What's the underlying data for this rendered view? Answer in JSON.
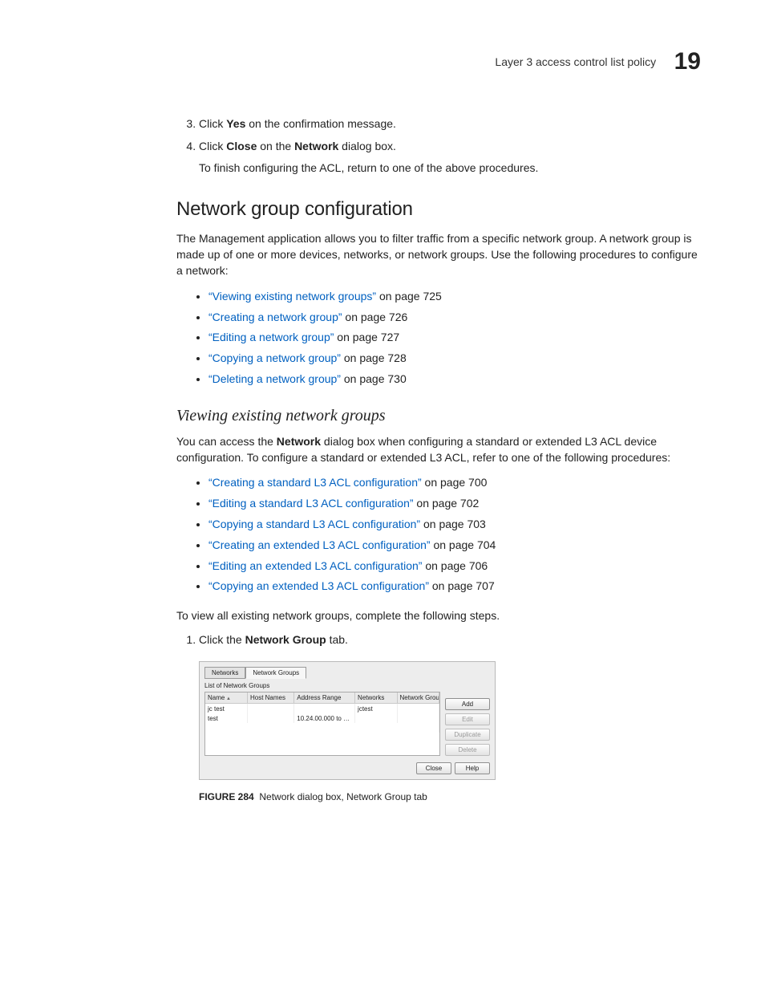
{
  "header": {
    "title": "Layer 3 access control list policy",
    "chapter": "19"
  },
  "steps_a": {
    "start": 3,
    "items": [
      {
        "pre": "Click ",
        "bold": "Yes",
        "post": " on the confirmation message."
      },
      {
        "pre": "Click ",
        "bold": "Close",
        "mid": " on the ",
        "bold2": "Network",
        "post": " dialog box.",
        "note": "To finish configuring the ACL, return to one of the above procedures."
      }
    ]
  },
  "section_h2": "Network group configuration",
  "para1_pre": "The Management application allows you to filter traffic from a specific network group. A network group is made up of one or more devices, networks, or network groups. Use the following procedures to configure a network:",
  "bullets1": [
    {
      "link": "“Viewing existing network groups”",
      "tail": " on page 725"
    },
    {
      "link": "“Creating a network group”",
      "tail": " on page 726"
    },
    {
      "link": "“Editing a network group”",
      "tail": " on page 727"
    },
    {
      "link": "“Copying a network group”",
      "tail": " on page 728"
    },
    {
      "link": "“Deleting a network group”",
      "tail": " on page 730"
    }
  ],
  "section_h3": "Viewing existing network groups",
  "para2": {
    "t1": "You can access the ",
    "b1": "Network",
    "t2": " dialog box when configuring a standard or extended L3 ACL device configuration. To configure a standard or extended L3 ACL, refer to one of the following procedures:"
  },
  "bullets2": [
    {
      "link": "“Creating a standard L3 ACL configuration”",
      "tail": " on page 700"
    },
    {
      "link": "“Editing a standard L3 ACL configuration”",
      "tail": " on page 702"
    },
    {
      "link": "“Copying a standard L3 ACL configuration”",
      "tail": " on page 703"
    },
    {
      "link": "“Creating an extended L3 ACL configuration”",
      "tail": " on page 704"
    },
    {
      "link": "“Editing an extended L3 ACL configuration”",
      "tail": " on page 706"
    },
    {
      "link": "“Copying an extended L3 ACL configuration”",
      "tail": " on page 707"
    }
  ],
  "para3": "To view all existing network groups, complete the following steps.",
  "steps_b": {
    "start": 1,
    "items": [
      {
        "pre": "Click the ",
        "bold": "Network Group",
        "post": " tab."
      }
    ]
  },
  "dialog": {
    "tabs": {
      "networks": "Networks",
      "network_groups": "Network Groups"
    },
    "list_label": "List of Network Groups",
    "columns": [
      "Name",
      "Host Names",
      "Address Range",
      "Networks",
      "Network Groups"
    ],
    "rows": [
      {
        "name": "jc test",
        "host": "",
        "range": "",
        "networks": "jctest",
        "groups": ""
      },
      {
        "name": "test",
        "host": "",
        "range": "10.24.00.000 to 10.2...",
        "networks": "",
        "groups": ""
      }
    ],
    "buttons": {
      "add": "Add",
      "edit": "Edit",
      "duplicate": "Duplicate",
      "delete": "Delete",
      "close": "Close",
      "help": "Help"
    }
  },
  "figure": {
    "label": "FIGURE 284",
    "caption": "Network dialog box, Network Group tab"
  }
}
